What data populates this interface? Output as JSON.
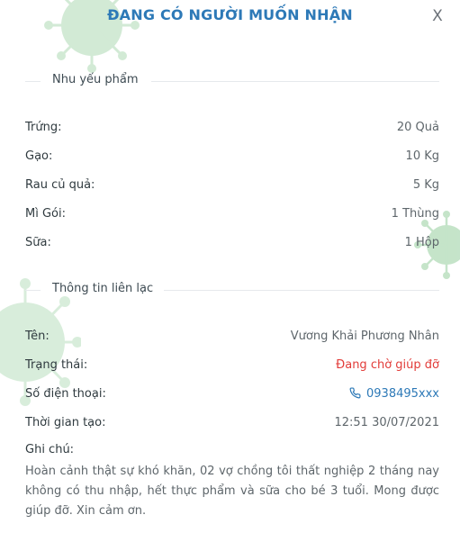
{
  "dialog": {
    "title": "ĐANG CÓ NGƯỜI MUỐN NHẬN",
    "close_label": "X"
  },
  "needs": {
    "heading": "Nhu yếu phẩm",
    "items": [
      {
        "label": "Trứng:",
        "value": "20 Quả"
      },
      {
        "label": "Gạo:",
        "value": "10 Kg"
      },
      {
        "label": "Rau củ quả:",
        "value": "5 Kg"
      },
      {
        "label": "Mì Gói:",
        "value": "1 Thùng"
      },
      {
        "label": "Sữa:",
        "value": "1 Hộp"
      }
    ]
  },
  "contact": {
    "heading": "Thông tin liên lạc",
    "name_label": "Tên:",
    "name_value": "Vương Khải Phương Nhân",
    "status_label": "Trạng thái:",
    "status_value": "Đang chờ giúp đỡ",
    "phone_label": "Số điện thoại:",
    "phone_value": "0938495xxx",
    "created_label": "Thời gian tạo:",
    "created_value": "12:51 30/07/2021",
    "note_label": "Ghi chú:",
    "note_value": "Hoàn cảnh thật sự khó khăn, 02 vợ chồng tôi thất nghiệp 2 tháng nay không có thu nhập, hết thực phẩm và sữa cho bé 3 tuổi. Mong được giúp đỡ. Xin cảm ơn."
  },
  "colors": {
    "title": "#2d79b7",
    "status": "#e23c39",
    "phone": "#2d79b7",
    "virus": "#7fc48a"
  },
  "icons": {
    "close": "close-icon",
    "phone": "phone-icon",
    "decoration": "virus-icon"
  }
}
